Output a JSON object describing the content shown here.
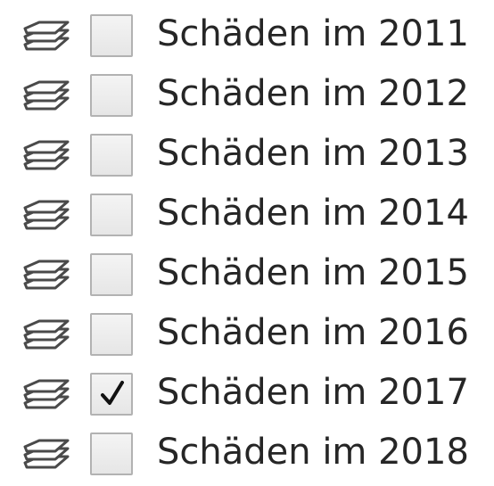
{
  "layer_list": {
    "icon": "layers-icon",
    "items": [
      {
        "label": "Schäden im 2011",
        "checked": false
      },
      {
        "label": "Schäden im 2012",
        "checked": false
      },
      {
        "label": "Schäden im 2013",
        "checked": false
      },
      {
        "label": "Schäden im 2014",
        "checked": false
      },
      {
        "label": "Schäden im 2015",
        "checked": false
      },
      {
        "label": "Schäden im 2016",
        "checked": false
      },
      {
        "label": "Schäden im 2017",
        "checked": true
      },
      {
        "label": "Schäden im 2018",
        "checked": false
      }
    ]
  }
}
